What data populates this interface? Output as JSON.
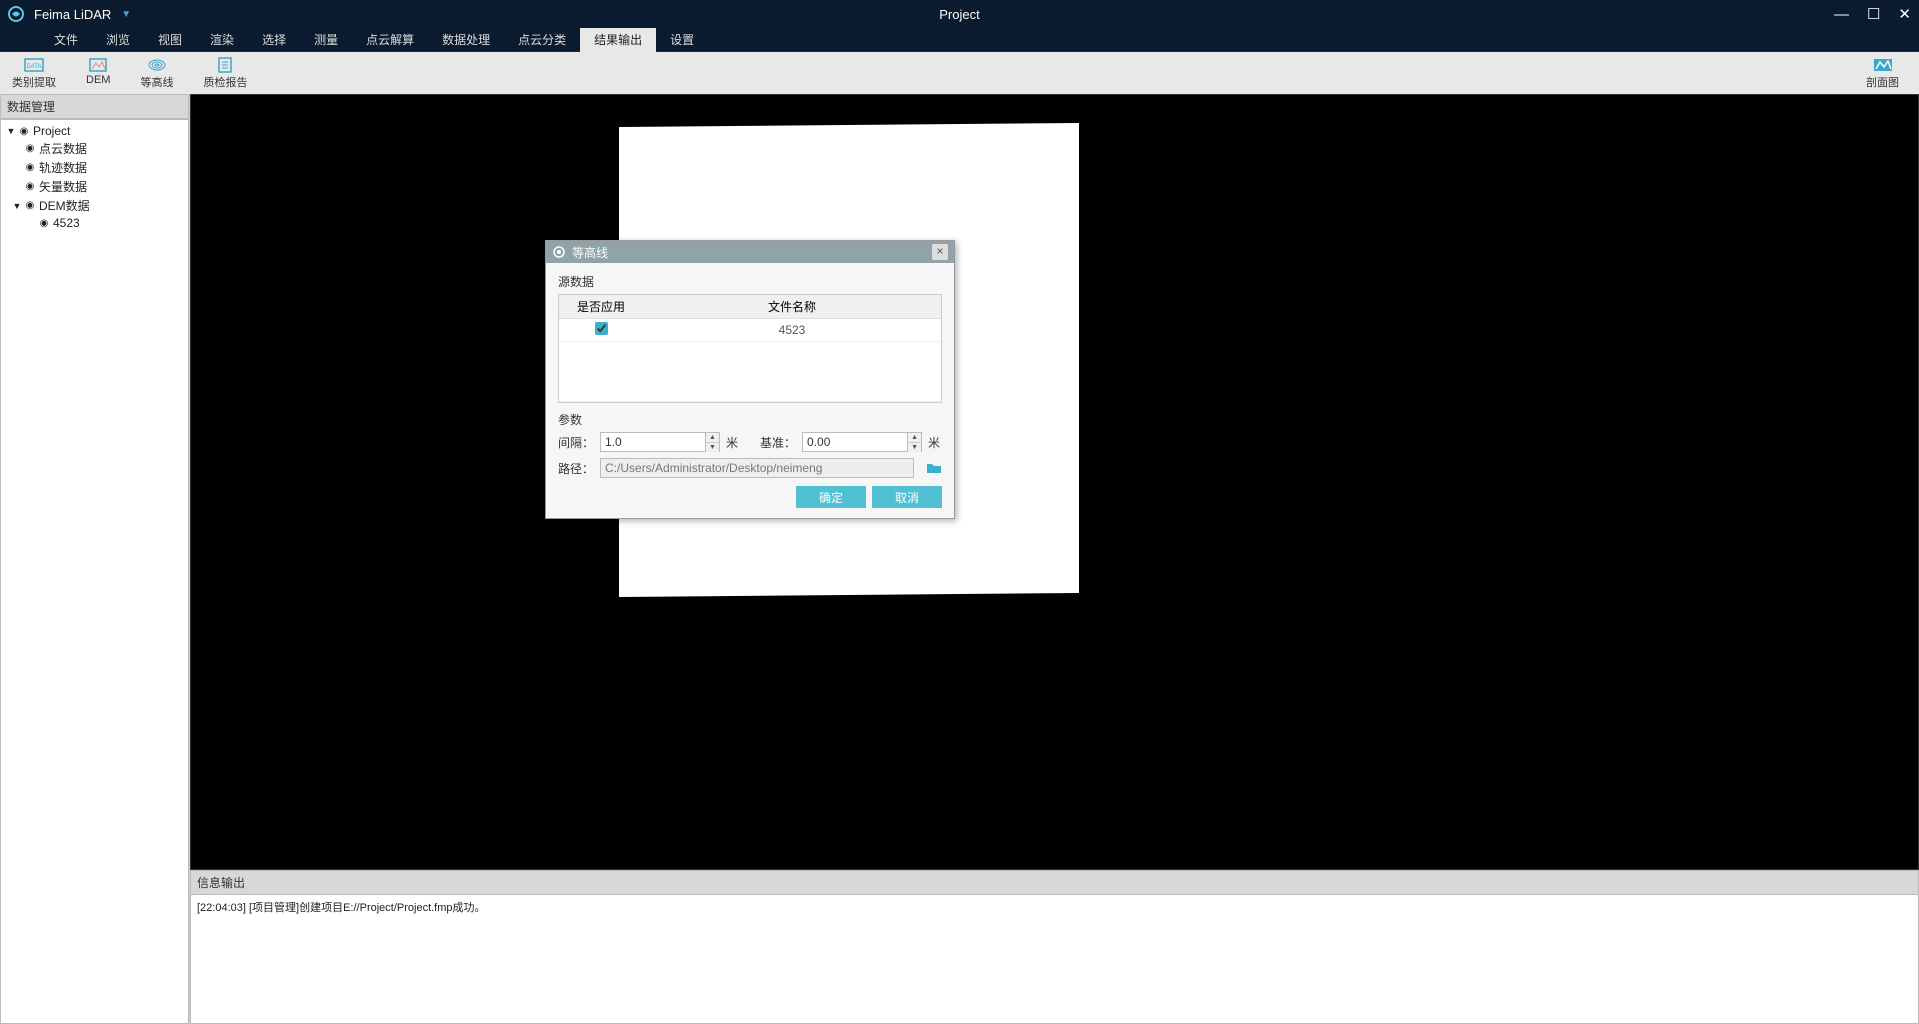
{
  "app": {
    "name": "Feima LiDAR",
    "window_title": "Project"
  },
  "menus": [
    "文件",
    "浏览",
    "视图",
    "渲染",
    "选择",
    "测量",
    "点云解算",
    "数据处理",
    "点云分类",
    "结果输出",
    "设置"
  ],
  "active_menu_index": 9,
  "toolbar": {
    "left": [
      {
        "id": "extract",
        "label": "类别提取"
      },
      {
        "id": "dem",
        "label": "DEM"
      },
      {
        "id": "contour",
        "label": "等高线"
      },
      {
        "id": "report",
        "label": "质检报告"
      }
    ],
    "right": [
      {
        "id": "section",
        "label": "剖面图"
      }
    ]
  },
  "sidebar": {
    "title": "数据管理",
    "tree": {
      "project": "Project",
      "children": [
        "点云数据",
        "轨迹数据",
        "矢量数据"
      ],
      "dem": {
        "label": "DEM数据",
        "children": [
          "4523"
        ]
      }
    }
  },
  "log": {
    "title": "信息输出",
    "entry": "[22:04:03] [项目管理]创建项目E://Project/Project.fmp成功。"
  },
  "dialog": {
    "title": "等高线",
    "source_label": "源数据",
    "table": {
      "col_apply": "是否应用",
      "col_filename": "文件名称",
      "row_file": "4523"
    },
    "params_label": "参数",
    "interval_label": "间隔：",
    "interval_value": "1.0",
    "interval_unit": "米",
    "base_label": "基准：",
    "base_value": "0.00",
    "base_unit": "米",
    "path_label": "路径：",
    "path_value": "C:/Users/Administrator/Desktop/neimeng",
    "ok": "确定",
    "cancel": "取消"
  }
}
